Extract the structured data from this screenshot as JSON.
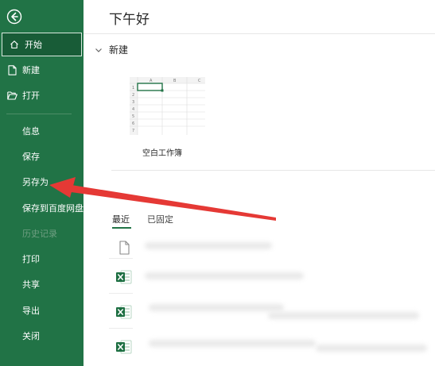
{
  "sidebar": {
    "primary_items": [
      {
        "label": "开始",
        "icon": "home-icon"
      },
      {
        "label": "新建",
        "icon": "new-file-icon"
      },
      {
        "label": "打开",
        "icon": "open-folder-icon"
      }
    ],
    "secondary_items": [
      {
        "label": "信息"
      },
      {
        "label": "保存"
      },
      {
        "label": "另存为"
      },
      {
        "label": "保存到百度网盘"
      },
      {
        "label": "历史记录"
      },
      {
        "label": "打印"
      },
      {
        "label": "共享"
      },
      {
        "label": "导出"
      },
      {
        "label": "关闭"
      }
    ],
    "background_color": "#217346"
  },
  "main": {
    "greeting": "下午好",
    "new_section": {
      "title": "新建",
      "templates": [
        {
          "label": "空白工作簿",
          "columns": [
            "A",
            "B",
            "C"
          ],
          "rows": [
            "1",
            "2",
            "3",
            "4",
            "5",
            "6",
            "7"
          ]
        }
      ]
    },
    "tabs": [
      {
        "label": "最近",
        "selected": true
      },
      {
        "label": "已固定",
        "selected": false
      }
    ],
    "files": [
      {
        "icon": "file-icon"
      },
      {
        "icon": "excel-icon"
      },
      {
        "icon": "excel-icon"
      },
      {
        "icon": "excel-icon"
      }
    ]
  },
  "colors": {
    "accent": "#217346",
    "arrow": "#e53935"
  }
}
